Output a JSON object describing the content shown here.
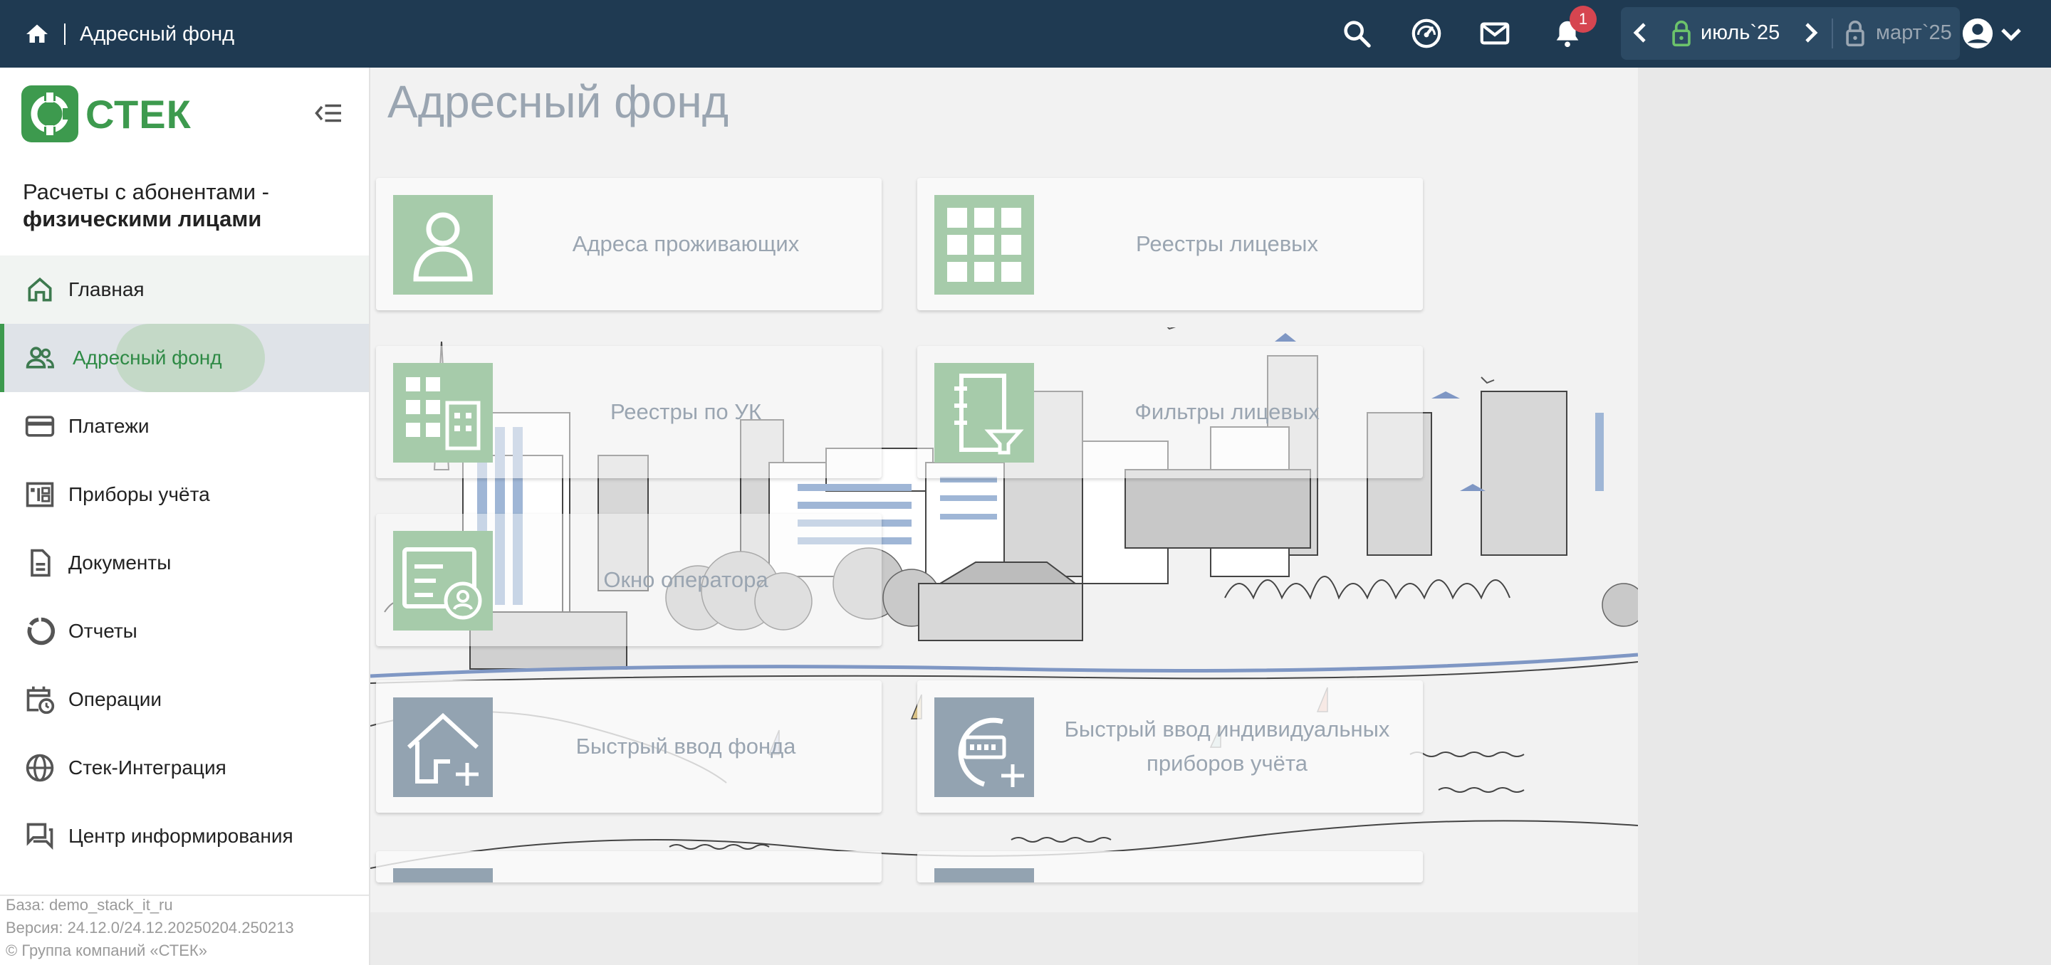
{
  "topbar": {
    "title": "Адресный фонд",
    "notifications_count": "1",
    "period_current": "июль`25",
    "period_closed": "март`25",
    "colors": {
      "background": "#1f3a52",
      "badge": "#d64550",
      "lock_open": "#6cc36b"
    },
    "icons": [
      "home-icon",
      "search-icon",
      "dashboard-icon",
      "mail-icon",
      "bell-icon",
      "chevron-left-icon",
      "lock-open-icon",
      "chevron-right-icon",
      "lock-icon",
      "account-icon",
      "chevron-down-icon"
    ]
  },
  "sidebar": {
    "logo_text": "СТЕК",
    "product_line1": "Расчеты с абонентами -",
    "product_line2": "физическими лицами",
    "items": [
      {
        "label": "Главная",
        "icon": "home-outline-icon"
      },
      {
        "label": "Адресный фонд",
        "icon": "people-icon",
        "active": true
      },
      {
        "label": "Платежи",
        "icon": "credit-card-icon"
      },
      {
        "label": "Приборы учёта",
        "icon": "meter-icon"
      },
      {
        "label": "Документы",
        "icon": "document-icon"
      },
      {
        "label": "Отчеты",
        "icon": "report-ring-icon"
      },
      {
        "label": "Операции",
        "icon": "calendar-clock-icon"
      },
      {
        "label": "Стек-Интеграция",
        "icon": "globe-icon"
      },
      {
        "label": "Центр информирования",
        "icon": "forum-icon"
      }
    ],
    "footer": {
      "base": "База: demo_stack_it_ru",
      "version": "Версия: 24.12.0/24.12.20250204.250213",
      "copyright": "© Группа компаний «СТЕК»"
    },
    "accent_color": "#3d9a4e"
  },
  "main": {
    "title": "Адресный фонд",
    "cards": [
      {
        "label": "Адреса проживающих",
        "icon": "person-icon"
      },
      {
        "label": "Реестры лицевых",
        "icon": "grid-icon"
      },
      {
        "label": "Реестры по УК",
        "icon": "buildings-icon"
      },
      {
        "label": "Фильтры лицевых",
        "icon": "notebook-filter-icon"
      },
      {
        "label": "Окно оператора",
        "icon": "operator-card-icon"
      },
      {
        "label": "Быстрый ввод фонда",
        "icon": "house-plus-icon"
      },
      {
        "label": "Быстрый ввод индивидуальных приборов учёта",
        "icon": "meter-plus-icon"
      }
    ]
  }
}
